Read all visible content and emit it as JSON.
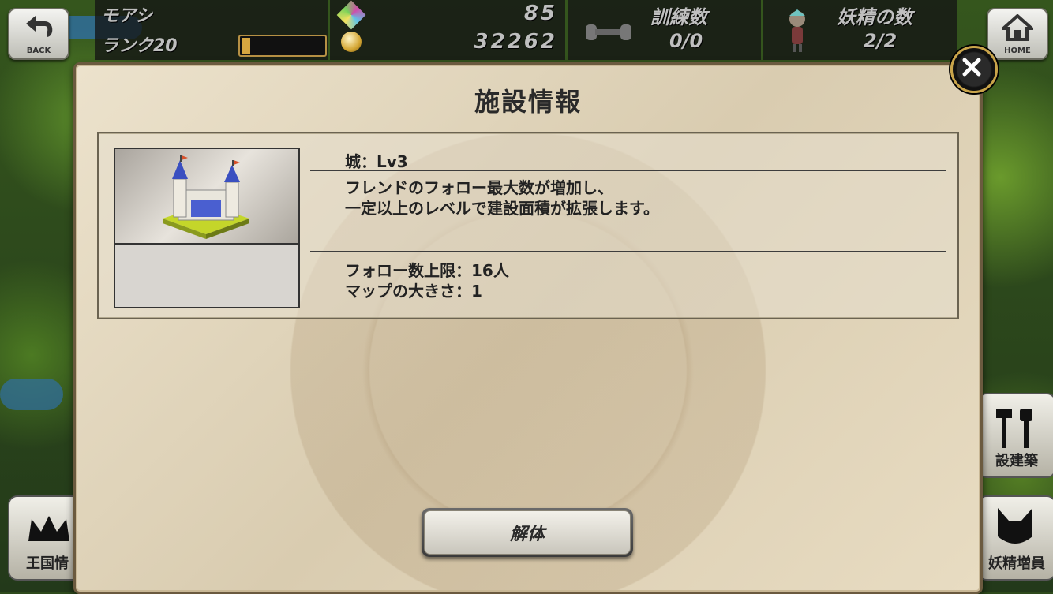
{
  "hud": {
    "player_name": "モアシ",
    "rank_label": "ランク20",
    "rank_progress": 0.1,
    "gems": "85",
    "coins": "32262",
    "training_label": "訓練数",
    "training_value": "0/0",
    "fairy_label": "妖精の数",
    "fairy_value": "2/2"
  },
  "nav": {
    "back_label": "BACK",
    "home_label": "HOME"
  },
  "side_buttons": {
    "kingdom": "王国情",
    "build": "設建築",
    "fairy_add": "妖精増員"
  },
  "dialog": {
    "title": "施設情報",
    "building_name": "城：Lv3",
    "description_line1": "フレンドのフォロー最大数が増加し、",
    "description_line2": "一定以上のレベルで建設面積が拡張します。",
    "stat_follow": "フォロー数上限：16人",
    "stat_map": "マップの大きさ：1",
    "dismantle_label": "解体"
  },
  "colors": {
    "accent_gold": "#c9a44a",
    "hud_bg": "#141414",
    "parchment": "#e6dcc4"
  }
}
